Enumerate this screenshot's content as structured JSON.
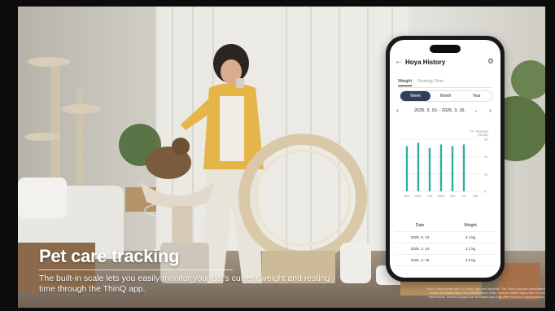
{
  "promo": {
    "headline": "Pet care tracking",
    "subline": "The built-in scale lets you easily monitor your cat's current weight and resting time through the ThinQ app.",
    "disclaimer": "*Wi-Fi connectivity and LG ThinQ app are required. The ThinQ app and associated names are trademarks of LG Electronics. Extra, and all related logos with LG are trademarks. Screen images are simulated and may differ from the actual product."
  },
  "app": {
    "title": "Hoya History",
    "back_icon": "back-arrow-icon",
    "settings_icon": "gear-icon",
    "tabs": [
      {
        "label": "Weight",
        "active": true
      },
      {
        "label": "Resting Time",
        "active": false
      }
    ],
    "periods": [
      {
        "label": "Week",
        "selected": true
      },
      {
        "label": "Month",
        "selected": false
      },
      {
        "label": "Year",
        "selected": false
      }
    ],
    "date_range": "2025. 3. 10. - 2025. 3. 16.",
    "colors": {
      "accent": "#2fae9a",
      "selected_period": "#2f3f5a"
    }
  },
  "chart_data": {
    "type": "bar",
    "categories": [
      "Sun",
      "Mon",
      "Tue",
      "Wed",
      "Thu",
      "Fri",
      "Sat"
    ],
    "series": [
      {
        "name": "Average",
        "values": [
          26,
          28,
          25,
          27,
          26,
          27,
          0
        ]
      }
    ],
    "ylabel": "(Hours)",
    "yticks": [
      0,
      10,
      20,
      30
    ],
    "ylim": [
      0,
      30
    ],
    "legend": "top-right",
    "grid": true
  },
  "table": {
    "headers": [
      "Date",
      "Weight"
    ],
    "rows": [
      [
        "2025. 3. 13",
        "2.4 kg"
      ],
      [
        "2025. 3. 14",
        "2.1 kg"
      ],
      [
        "2025. 3. 15",
        "2.5 kg"
      ]
    ]
  }
}
